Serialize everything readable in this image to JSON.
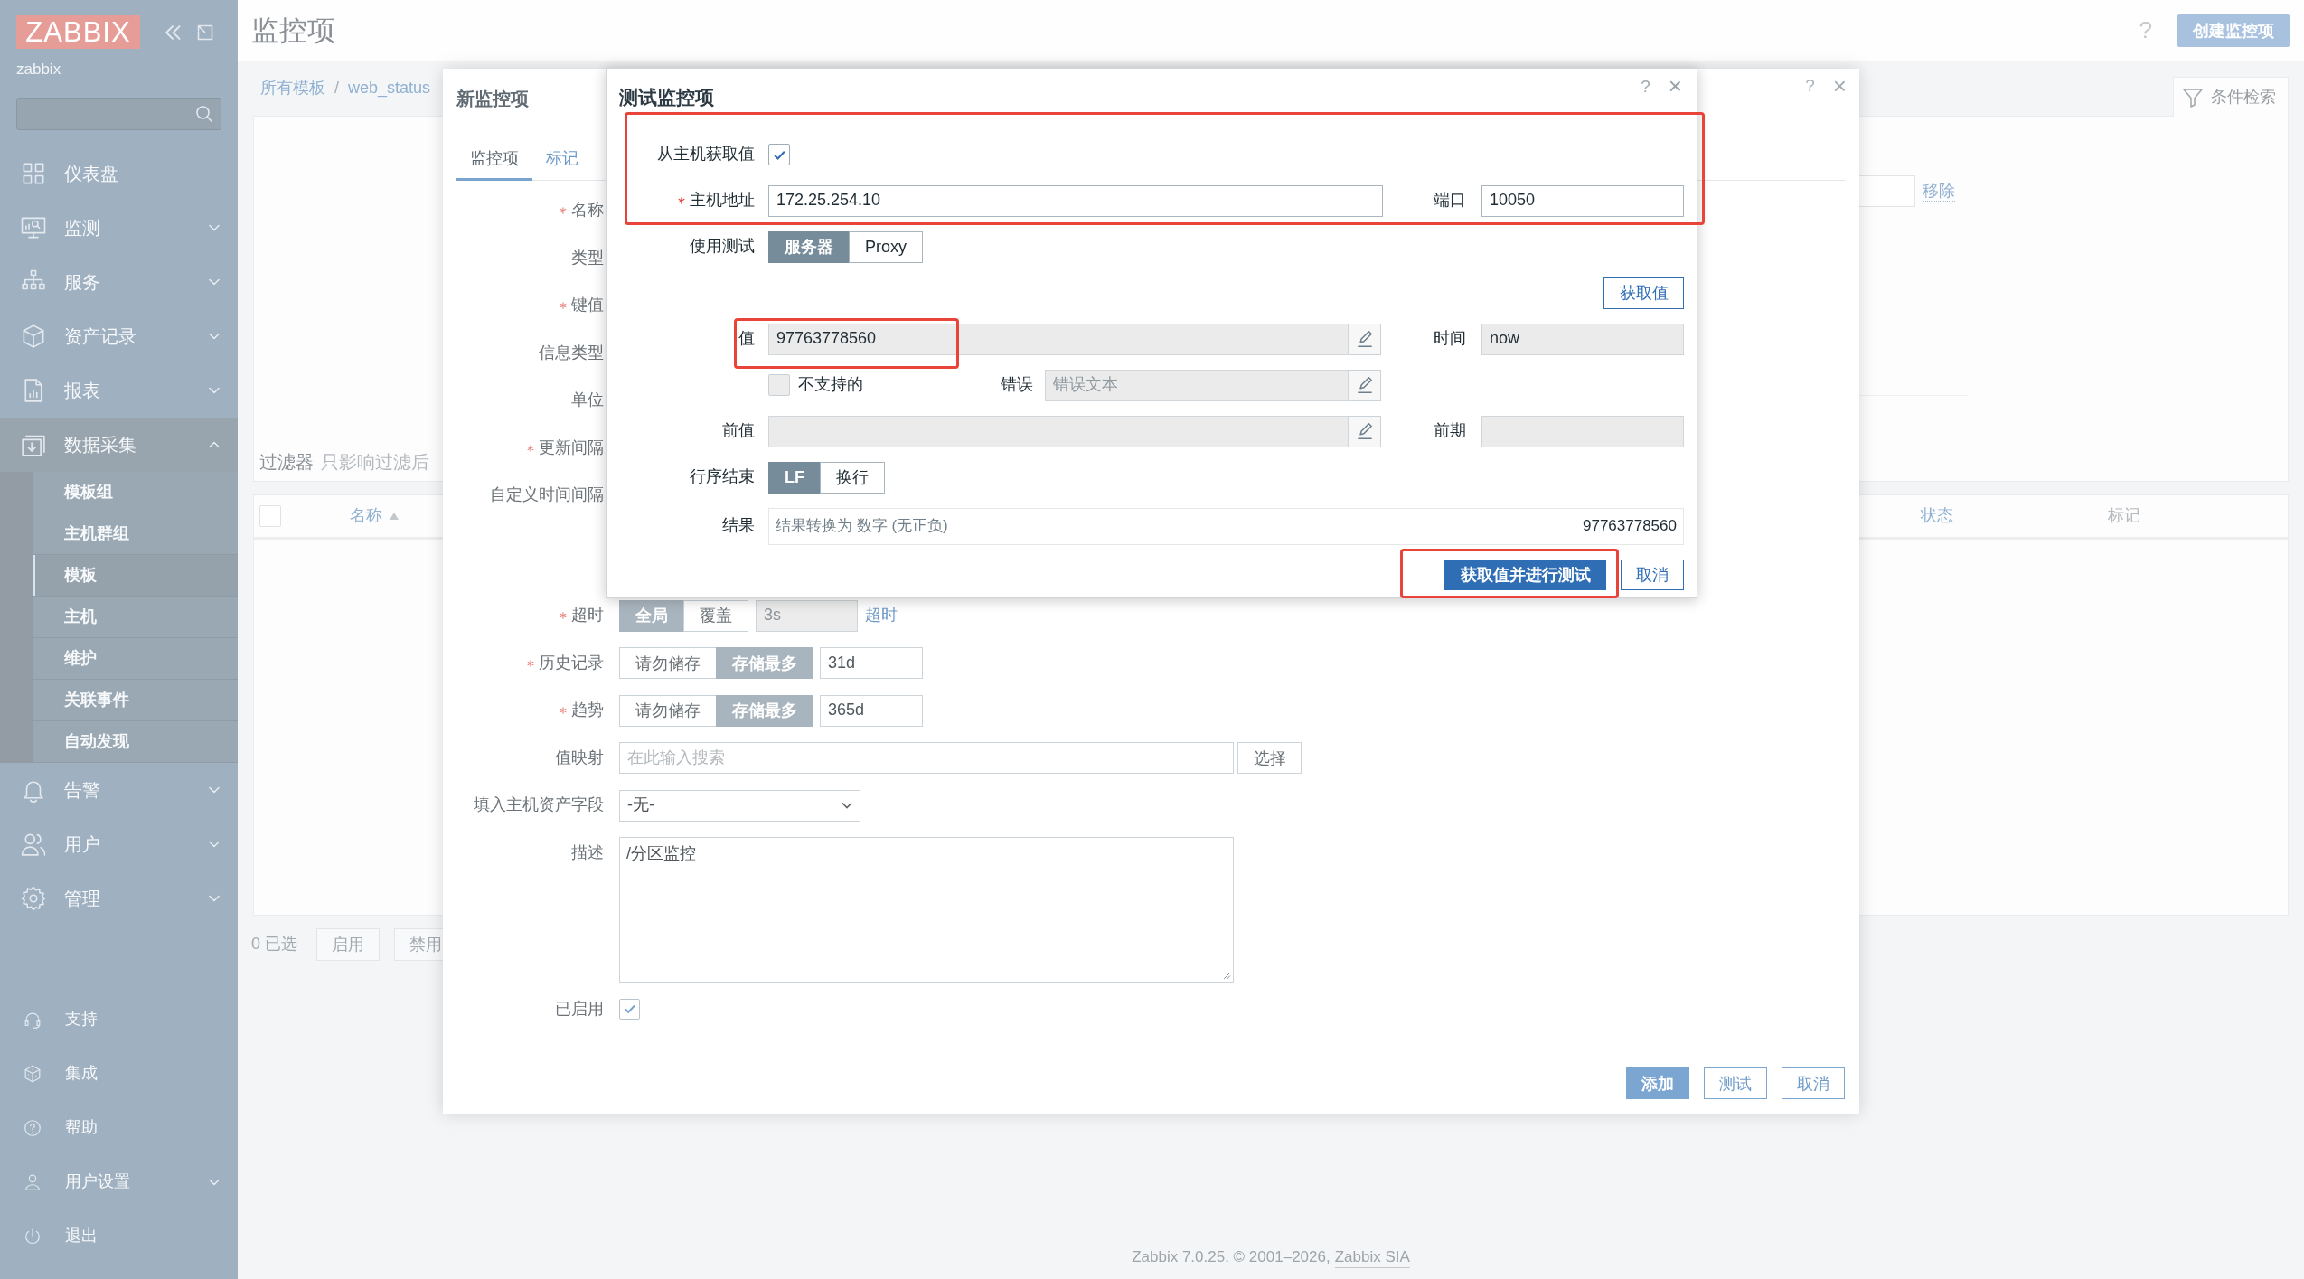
{
  "sidebar": {
    "logo": "ZABBIX",
    "server": "zabbix",
    "menu": [
      {
        "label": "仪表盘",
        "kind": "link"
      },
      {
        "label": "监测",
        "kind": "group",
        "expanded": false
      },
      {
        "label": "服务",
        "kind": "group",
        "expanded": false
      },
      {
        "label": "资产记录",
        "kind": "group",
        "expanded": false
      },
      {
        "label": "报表",
        "kind": "group",
        "expanded": false
      },
      {
        "label": "数据采集",
        "kind": "group",
        "expanded": true,
        "children": [
          {
            "label": "模板组",
            "selected": false
          },
          {
            "label": "主机群组",
            "selected": false
          },
          {
            "label": "模板",
            "selected": true
          },
          {
            "label": "主机",
            "selected": false
          },
          {
            "label": "维护",
            "selected": false
          },
          {
            "label": "关联事件",
            "selected": false
          },
          {
            "label": "自动发现",
            "selected": false
          }
        ]
      },
      {
        "label": "告警",
        "kind": "group",
        "expanded": false
      },
      {
        "label": "用户",
        "kind": "group",
        "expanded": false
      },
      {
        "label": "管理",
        "kind": "group",
        "expanded": false
      }
    ],
    "user_menu": [
      {
        "label": "支持",
        "kind": "link"
      },
      {
        "label": "集成",
        "kind": "link"
      },
      {
        "label": "帮助",
        "kind": "link"
      },
      {
        "label": "用户设置",
        "kind": "group",
        "expanded": false
      },
      {
        "label": "退出",
        "kind": "link"
      }
    ]
  },
  "header": {
    "title": "监控项",
    "help": "?",
    "create_button": "创建监控项"
  },
  "breadcrumb": {
    "items": [
      "所有模板",
      "web_status"
    ],
    "separator": "/"
  },
  "filter": {
    "tab": "条件检索",
    "label": "过滤器",
    "note": "只影响过滤后",
    "remove_link": "移除"
  },
  "table": {
    "all_selected": false,
    "columns": [
      {
        "label": "名称",
        "sortable": true,
        "sorted": true
      },
      {
        "label": "状态",
        "sortable": true,
        "sorted": false
      },
      {
        "label": "标记",
        "sortable": false,
        "sorted": false
      }
    ],
    "selected_count": "0 已选",
    "actions": [
      "启用",
      "禁用"
    ]
  },
  "item_form": {
    "title": "新监控项",
    "help": "?",
    "close": "×",
    "tabs": [
      {
        "label": "监控项",
        "selected": true
      },
      {
        "label": "标记",
        "selected": false
      }
    ],
    "rows": [
      {
        "label": "名称",
        "required": true,
        "kind": "covered"
      },
      {
        "label": "类型",
        "required": false,
        "kind": "covered"
      },
      {
        "label": "键值",
        "required": true,
        "kind": "covered"
      },
      {
        "label": "信息类型",
        "required": false,
        "kind": "covered"
      },
      {
        "label": "单位",
        "required": false,
        "kind": "covered"
      },
      {
        "label": "更新间隔",
        "required": true,
        "kind": "covered"
      },
      {
        "label": "自定义时间间隔",
        "required": false,
        "kind": "covered_table"
      },
      {
        "label": "超时",
        "required": true,
        "kind": "timeout",
        "options": [
          {
            "label": "全局",
            "selected": true
          },
          {
            "label": "覆盖",
            "selected": false
          }
        ],
        "value": "3s",
        "disabled": true,
        "link": "超时"
      },
      {
        "label": "历史记录",
        "required": true,
        "kind": "storage",
        "options": [
          {
            "label": "请勿储存",
            "selected": false
          },
          {
            "label": "存储最多",
            "selected": true
          }
        ],
        "value": "31d"
      },
      {
        "label": "趋势",
        "required": true,
        "kind": "storage",
        "options": [
          {
            "label": "请勿储存",
            "selected": false
          },
          {
            "label": "存储最多",
            "selected": true
          }
        ],
        "value": "365d"
      },
      {
        "label": "值映射",
        "required": false,
        "kind": "lookup",
        "placeholder": "在此输入搜索",
        "button": "选择"
      },
      {
        "label": "填入主机资产字段",
        "required": false,
        "kind": "select",
        "value": "-无-"
      },
      {
        "label": "描述",
        "required": false,
        "kind": "textarea",
        "value": "/分区监控"
      },
      {
        "label": "已启用",
        "required": false,
        "kind": "checkbox",
        "checked": true
      }
    ],
    "buttons": [
      {
        "label": "添加",
        "primary": true
      },
      {
        "label": "测试",
        "primary": false
      },
      {
        "label": "取消",
        "primary": false
      }
    ]
  },
  "test_dialog": {
    "title": "测试监控项",
    "help": "?",
    "close": "×",
    "host_section": {
      "highlighted": true,
      "get_from_host": {
        "label": "从主机获取值",
        "checked": true
      },
      "address": {
        "label": "主机地址",
        "required": true,
        "value": "172.25.254.10"
      },
      "port": {
        "label": "端口",
        "value": "10050"
      }
    },
    "test_with": {
      "label": "使用测试",
      "options": [
        {
          "label": "服务器",
          "selected": true
        },
        {
          "label": "Proxy",
          "selected": false
        }
      ]
    },
    "get_value_button": "获取值",
    "value": {
      "label": "值",
      "value": "97763778560",
      "highlighted": true
    },
    "time": {
      "label": "时间",
      "value": "now"
    },
    "unsupported": {
      "label": "不支持的",
      "checked": false
    },
    "error": {
      "label": "错误",
      "placeholder": "错误文本"
    },
    "previous_value": {
      "label": "前值"
    },
    "previous_time": {
      "label": "前期"
    },
    "eol": {
      "label": "行序结束",
      "options": [
        {
          "label": "LF",
          "selected": true
        },
        {
          "label": "换行",
          "selected": false
        }
      ]
    },
    "result": {
      "label": "结果",
      "note": "结果转换为 数字 (无正负)",
      "value": "97763778560"
    },
    "buttons": [
      {
        "label": "获取值并进行测试",
        "primary": true,
        "highlighted": true
      },
      {
        "label": "取消",
        "primary": false,
        "highlighted": false
      }
    ]
  },
  "footer": {
    "text": "Zabbix 7.0.25. © 2001–2026,",
    "link": "Zabbix SIA"
  }
}
